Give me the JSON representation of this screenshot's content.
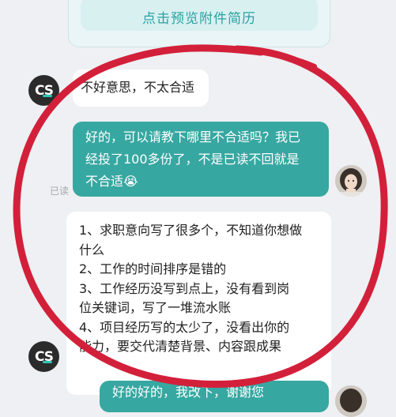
{
  "top_card": {
    "preview_button_label": "点击预览附件简历"
  },
  "messages": [
    {
      "sender": "recruiter",
      "avatar_text": "CS",
      "text": "不好意思，不太合适"
    },
    {
      "sender": "me",
      "lines": [
        "好的，可以请教下哪里不合适吗？我已",
        "经投了100多份了，不是已读不回就是",
        "不合适😭"
      ],
      "status": "已读"
    },
    {
      "sender": "recruiter",
      "avatar_text": "CS",
      "lines": [
        "1、求职意向写了很多个，不知道你想做",
        "什么",
        "2、工作的时间排序是错的",
        "3、工作经历没写到点上，没有看到岗",
        "位关键词，写了一堆流水账",
        "4、项目经历写的太少了，没看出你的",
        "能力，要交代清楚背景、内容跟成果"
      ]
    },
    {
      "sender": "me",
      "text": "好的好的，我改下，谢谢您"
    }
  ],
  "colors": {
    "background": "#eef0f3",
    "my_bubble": "#37a7a1",
    "annotation_circle": "#d3203a",
    "preview_text": "#2aa1a1"
  }
}
